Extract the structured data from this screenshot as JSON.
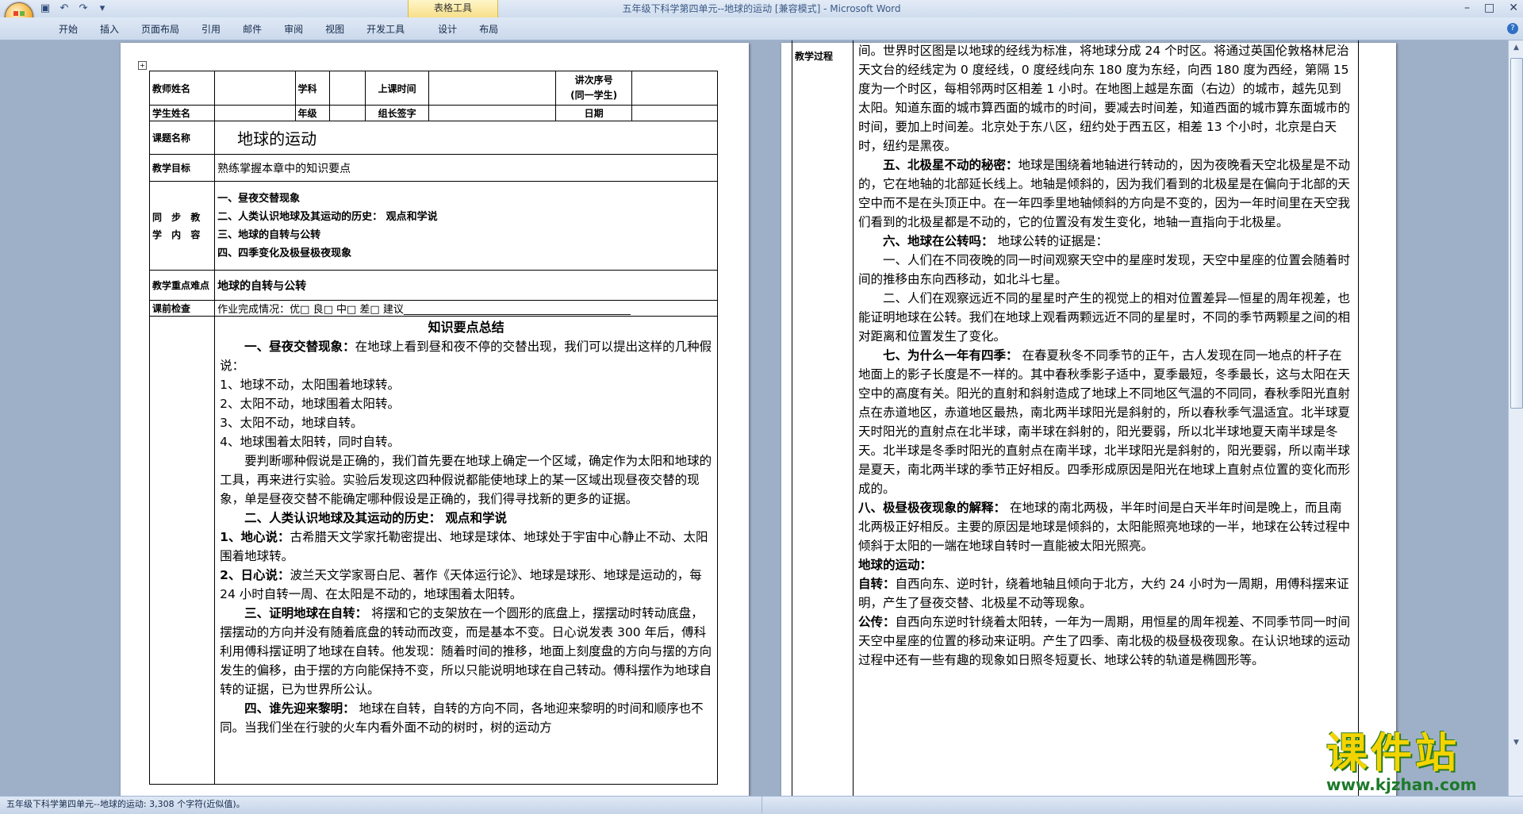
{
  "window": {
    "title": "五年级下科学第四单元--地球的运动 [兼容模式] - Microsoft Word",
    "context_group": "表格工具"
  },
  "qat_icons": [
    "save-icon",
    "undo-icon",
    "redo-icon",
    "customize-icon"
  ],
  "ribbon_tabs": [
    "开始",
    "插入",
    "页面布局",
    "引用",
    "邮件",
    "审阅",
    "视图",
    "开发工具",
    "设计",
    "布局"
  ],
  "header_table": {
    "teacher_label": "教师姓名",
    "subject_label": "学科",
    "class_time_label": "上课时间",
    "lecture_no_label": "讲次序号",
    "lecture_no_sub": "(同一学生)",
    "student_label": "学生姓名",
    "grade_label": "年级",
    "leader_sign_label": "组长签字",
    "date_label": "日期",
    "topic_label": "课题名称",
    "topic": "地球的运动",
    "goal_label": "教学目标",
    "goal": "熟练掌握本章中的知识要点",
    "sync_label": "同 步 教 学 内 容",
    "sync_items": [
      "一、昼夜交替现象",
      "二、人类认识地球及其运动的历史： 观点和学说",
      "三、地球的自转与公转",
      "四、四季变化及极昼极夜现象"
    ],
    "key_label": "教学重点难点",
    "key": "地球的自转与公转",
    "precheck_label": "课前检查",
    "precheck": "作业完成情况：优□ 良□ 中□ 差□ 建议____________________________________________"
  },
  "page1": {
    "heading": "知识要点总结",
    "paragraphs": [
      {
        "bold": "一、昼夜交替现象：",
        "text": "在地球上看到昼和夜不停的交替出现，我们可以提出这样的几种假说：",
        "indent": true
      },
      {
        "bold": "",
        "text": "1、地球不动，太阳围着地球转。",
        "indent": false
      },
      {
        "bold": "",
        "text": "2、太阳不动，地球围着太阳转。",
        "indent": false
      },
      {
        "bold": "",
        "text": "3、太阳不动，地球自转。",
        "indent": false
      },
      {
        "bold": "",
        "text": "4、地球围着太阳转，同时自转。",
        "indent": false
      },
      {
        "bold": "",
        "text": "要判断哪种假说是正确的，我们首先要在地球上确定一个区域，确定作为太阳和地球的工具，再来进行实验。实验后发现这四种假说都能使地球上的某一区域出现昼夜交替的现象，单是昼夜交替不能确定哪种假设是正确的，我们得寻找新的更多的证据。",
        "indent": true
      },
      {
        "bold": "二、人类认识地球及其运动的历史： 观点和学说",
        "text": "",
        "indent": true
      },
      {
        "bold": "1、地心说：",
        "text": "古希腊天文学家托勒密提出、地球是球体、地球处于宇宙中心静止不动、太阳围着地球转。",
        "indent": false
      },
      {
        "bold": "2、日心说：",
        "text": "波兰天文学家哥白尼、著作《天体运行论》、地球是球形、地球是运动的，每 24 小时自转一周、在太阳是不动的，地球围着太阳转。",
        "indent": false
      },
      {
        "bold": "三、证明地球在自转：",
        "text": " 将摆和它的支架放在一个圆形的底盘上，摆摆动时转动底盘，摆摆动的方向并没有随着底盘的转动而改变，而是基本不变。日心说发表 300 年后，傅科利用傅科摆证明了地球在自转。他发现：随着时间的推移，地面上刻度盘的方向与摆的方向发生的偏移，由于摆的方向能保持不变，所以只能说明地球在自己转动。傅科摆作为地球自转的证据，已为世界所公认。",
        "indent": true
      },
      {
        "bold": "四、谁先迎来黎明：",
        "text": " 地球在自转，自转的方向不同，各地迎来黎明的时间和顺序也不同。当我们坐在行驶的火车内看外面不动的树时，树的运动方",
        "indent": true
      }
    ]
  },
  "page2": {
    "label": "教学过程",
    "paragraphs": [
      {
        "bold": "",
        "text": "间。世界时区图是以地球的经线为标准，将地球分成 24 个时区。将通过英国伦敦格林尼治天文台的经线定为 0 度经线，0 度经线向东 180 度为东经，向西 180 度为西经，第隔 15 度为一个时区，每相邻两时区相差 1 小时。在地图上越是东面（右边）的城市，越先见到太阳。知道东面的城市算西面的城市的时间，要减去时间差，知道西面的城市算东面城市的时间，要加上时间差。北京处于东八区，纽约处于西五区，相差 13 个小时，北京是白天时，纽约是黑夜。",
        "indent": false
      },
      {
        "bold": "五、北极星不动的秘密：",
        "text": "地球是围绕着地轴进行转动的，因为夜晚看天空北极星是不动的，它在地轴的北部延长线上。地轴是倾斜的，因为我们看到的北极星是在偏向于北部的天空中而不是在头顶正中。在一年四季里地轴倾斜的方向是不变的，因为一年时间里在天空我们看到的北极星都是不动的，它的位置没有发生变化，地轴一直指向于北极星。",
        "indent": true
      },
      {
        "bold": "六、地球在公转吗：",
        "text": " 地球公转的证据是：",
        "indent": true
      },
      {
        "bold": "",
        "text": "一、人们在不同夜晚的同一时间观察天空中的星座时发现，天空中星座的位置会随着时间的推移由东向西移动，如北斗七星。",
        "indent": true
      },
      {
        "bold": "",
        "text": "二、人们在观察远近不同的星星时产生的视觉上的相对位置差异—恒星的周年视差，也能证明地球在公转。我们在地球上观看两颗远近不同的星星时，不同的季节两颗星之间的相对距离和位置发生了变化。",
        "indent": true
      },
      {
        "bold": "七、为什么一年有四季：",
        "text": " 在春夏秋冬不同季节的正午，古人发现在同一地点的杆子在地面上的影子长度是不一样的。其中春秋季影子适中，夏季最短，冬季最长，这与太阳在天空中的高度有关。阳光的直射和斜射造成了地球上不同地区气温的不同同，春秋季阳光直射点在赤道地区，赤道地区最热，南北两半球阳光是斜射的，所以春秋季气温适宜。北半球夏天时阳光的直射点在北半球，南半球在斜射的，阳光要弱，所以北半球地夏天南半球是冬天。北半球是冬季时阳光的直射点在南半球，北半球阳光是斜射的，阳光要弱，所以南半球是夏天，南北两半球的季节正好相反。四季形成原因是阳光在地球上直射点位置的变化而形成的。",
        "indent": true
      },
      {
        "bold": "八、极昼极夜现象的解释：",
        "text": " 在地球的南北两极，半年时间是白天半年时间是晚上，而且南北两极正好相反。主要的原因是地球是倾斜的，太阳能照亮地球的一半，地球在公转过程中倾斜于太阳的一端在地球自转时一直能被太阳光照亮。",
        "indent": false
      },
      {
        "bold": "地球的运动：",
        "text": "",
        "indent": false
      },
      {
        "bold": "自转：",
        "text": "自西向东、逆时针，绕着地轴且倾向于北方，大约 24 小时为一周期，用傅科摆来证明，产生了昼夜交替、北极星不动等现象。",
        "indent": false
      },
      {
        "bold": "公传：",
        "text": "自西向东逆时针绕着太阳转，一年为一周期，用恒星的周年视差、不同季节同一时间天空中星座的位置的移动来证明。产生了四季、南北极的极昼极夜现象。在认识地球的运动过程中还有一些有趣的现象如日照冬短夏长、地球公转的轨道是椭圆形等。",
        "indent": false
      }
    ]
  },
  "status": {
    "text": "五年级下科学第四单元--地球的运动: 3,308 个字符(近似值)。"
  },
  "watermark": {
    "cn": "课件站",
    "url": "www.kjzhan.com"
  }
}
